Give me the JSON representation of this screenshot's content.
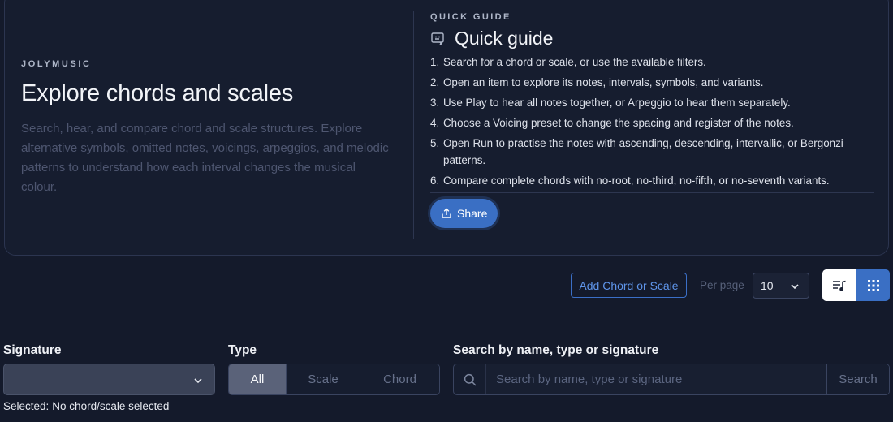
{
  "hero": {
    "eyebrow": "JOLYMUSIC",
    "title": "Explore chords and scales",
    "description": "Search, hear, and compare chord and scale structures. Explore alternative symbols, omitted notes, voicings, arpeggios, and melodic patterns to understand how each interval changes the musical colour."
  },
  "guide": {
    "eyebrow": "QUICK GUIDE",
    "title": "Quick guide",
    "icon": "guide-icon",
    "steps": [
      {
        "num": "1.",
        "text": "Search for a chord or scale, or use the available filters."
      },
      {
        "num": "2.",
        "text": "Open an item to explore its notes, intervals, symbols, and variants."
      },
      {
        "num": "3.",
        "text": "Use Play to hear all notes together, or Arpeggio to hear them separately."
      },
      {
        "num": "4.",
        "text": "Choose a Voicing preset to change the spacing and register of the notes."
      },
      {
        "num": "5.",
        "text": "Open Run to practise the notes with ascending, descending, intervallic, or Bergonzi patterns."
      },
      {
        "num": "6.",
        "text": "Compare complete chords with no-root, no-third, no-fifth, or no-seventh variants."
      }
    ],
    "share_label": "Share"
  },
  "toolbar": {
    "add_label": "Add Chord or Scale",
    "per_page_label": "Per page",
    "per_page_value": "10"
  },
  "filters": {
    "signature_label": "Signature",
    "signature_value": "",
    "selected_label": "Selected:",
    "selected_value": "No chord/scale selected",
    "type_label": "Type",
    "type_options": [
      "All",
      "Scale",
      "Chord"
    ],
    "type_selected": "All",
    "search_label": "Search by name, type or signature",
    "search_placeholder": "Search by name, type or signature",
    "search_value": "",
    "search_button": "Search"
  },
  "colors": {
    "accent": "#3a6fc4",
    "background": "#141a2b"
  }
}
